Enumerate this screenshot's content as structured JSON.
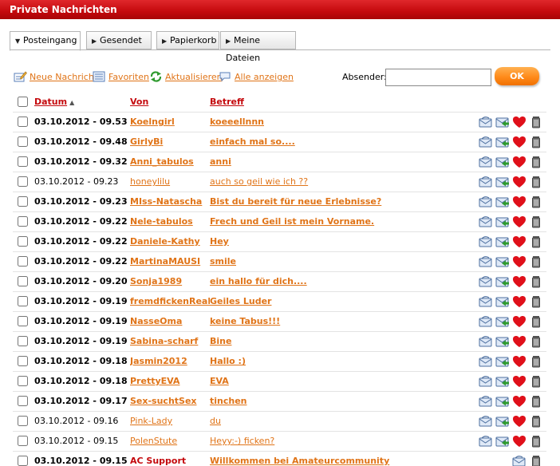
{
  "window": {
    "title": "Private Nachrichten"
  },
  "tabs": [
    {
      "label": "Posteingang",
      "active": true
    },
    {
      "label": "Gesendet",
      "active": false
    },
    {
      "label": "Papierkorb",
      "active": false
    },
    {
      "label": "Meine Dateien",
      "active": false
    }
  ],
  "toolbar": {
    "new_message": "Neue Nachricht",
    "favorites": "Favoriten",
    "refresh": "Aktualisieren",
    "show_all": "Alle anzeigen",
    "sender_label": "Absender:",
    "sender_value": "",
    "ok_label": "OK"
  },
  "table": {
    "headers": {
      "date": "Datum",
      "from": "Von",
      "subject": "Betreff"
    },
    "rows": [
      {
        "date": "03.10.2012 - 09.53",
        "from": "Koelngirl",
        "subject": "koeeellnnn",
        "read": false
      },
      {
        "date": "03.10.2012 - 09.48",
        "from": "GirlyBi",
        "subject": "einfach mal so....",
        "read": false
      },
      {
        "date": "03.10.2012 - 09.32",
        "from": "Anni_tabulos",
        "subject": "anni",
        "read": false
      },
      {
        "date": "03.10.2012 - 09.23",
        "from": "honeylilu",
        "subject": "auch so geil wie ich ??",
        "read": true
      },
      {
        "date": "03.10.2012 - 09.23",
        "from": "MIss-Natascha",
        "subject": "Bist du bereit für neue Erlebnisse?",
        "read": false
      },
      {
        "date": "03.10.2012 - 09.22",
        "from": "Nele-tabulos",
        "subject": "Frech und Geil ist mein Vorname.",
        "read": false
      },
      {
        "date": "03.10.2012 - 09.22",
        "from": "Daniele-Kathy",
        "subject": "Hey",
        "read": false
      },
      {
        "date": "03.10.2012 - 09.22",
        "from": "MartinaMAUSI",
        "subject": "smile",
        "read": false
      },
      {
        "date": "03.10.2012 - 09.20",
        "from": "Sonja1989",
        "subject": "ein hallo für dich....",
        "read": false
      },
      {
        "date": "03.10.2012 - 09.19",
        "from": "fremdfickenReal",
        "subject": "Geiles Luder",
        "read": false
      },
      {
        "date": "03.10.2012 - 09.19",
        "from": "NasseOma",
        "subject": "keine Tabus!!!",
        "read": false
      },
      {
        "date": "03.10.2012 - 09.19",
        "from": "Sabina-scharf",
        "subject": "Bine",
        "read": false
      },
      {
        "date": "03.10.2012 - 09.18",
        "from": "Jasmin2012",
        "subject": "Hallo :)",
        "read": false
      },
      {
        "date": "03.10.2012 - 09.18",
        "from": "PrettyEVA",
        "subject": "EVA",
        "read": false
      },
      {
        "date": "03.10.2012 - 09.17",
        "from": "Sex-suchtSex",
        "subject": "tinchen",
        "read": false
      },
      {
        "date": "03.10.2012 - 09.16",
        "from": "Pink-Lady",
        "subject": "du",
        "read": true
      },
      {
        "date": "03.10.2012 - 09.15",
        "from": "PolenStute",
        "subject": "Heyy:-) ficken?",
        "read": true
      },
      {
        "date": "03.10.2012 - 09.15",
        "from": "AC Support",
        "subject": "Willkommen bei Amateurcommunity",
        "read": false,
        "support": true
      }
    ]
  },
  "icons": {
    "reply": "envelope-reply-icon",
    "forward": "envelope-forward-icon",
    "favorite": "heart-icon",
    "delete": "trash-icon"
  },
  "colors": {
    "brand_red": "#c4090d",
    "link_orange": "#e07418",
    "ok_orange": "#ff8a1a"
  }
}
